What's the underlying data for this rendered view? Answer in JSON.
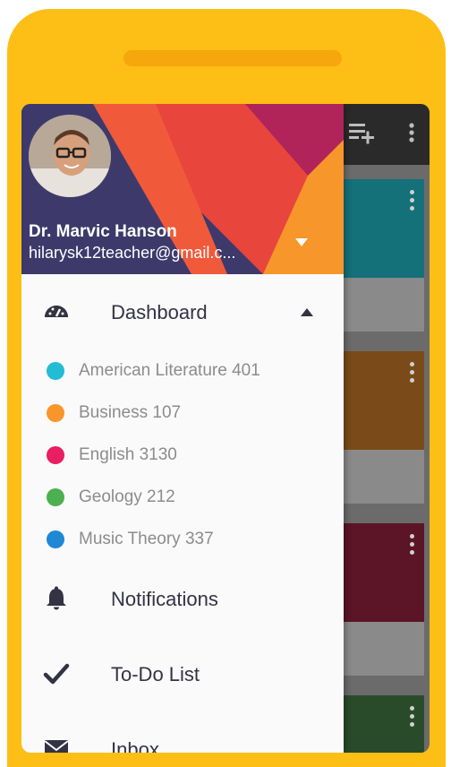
{
  "colors": {
    "device": "#fdbe16",
    "drawer_bg": "#fafafa",
    "header_purple": "#3d3a6b",
    "text_primary": "#333344",
    "text_secondary": "#8c8c8c"
  },
  "header": {
    "user_name": "Dr. Marvic Hanson",
    "user_email": "hilarysk12teacher@gmail.c..."
  },
  "menu": {
    "dashboard": "Dashboard",
    "notifications": "Notifications",
    "todo": "To-Do List",
    "inbox": "Inbox"
  },
  "courses": [
    {
      "label": "American Literature 401",
      "color": "#22bcd4"
    },
    {
      "label": "Business 107",
      "color": "#f7962a"
    },
    {
      "label": "English 3130",
      "color": "#e91e63"
    },
    {
      "label": "Geology 212",
      "color": "#4caf50"
    },
    {
      "label": "Music Theory 337",
      "color": "#1e88d4"
    }
  ],
  "background_cards": [
    {
      "color": "#147079"
    },
    {
      "color": "#7a4b18"
    },
    {
      "color": "#5c1427"
    },
    {
      "color": "#2a4b2a"
    }
  ],
  "icons": {
    "dashboard": "speedometer-icon",
    "notifications": "bell-icon",
    "todo": "checkmark-icon",
    "inbox": "envelope-icon",
    "topbar_add": "playlist-add-icon",
    "topbar_more": "more-vert-icon"
  }
}
